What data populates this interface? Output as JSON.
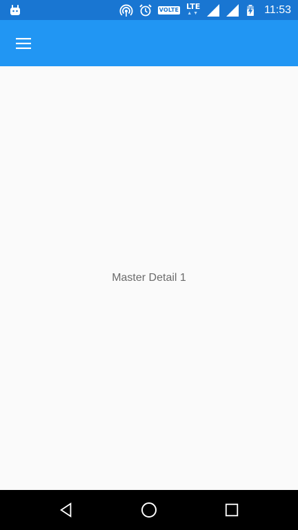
{
  "status_bar": {
    "time": "11:53",
    "network_badge": "VOLTE",
    "network_type": "LTE",
    "network_arrows": "▲▼",
    "icons": [
      "android-notification-icon",
      "hotspot-icon",
      "alarm-icon",
      "volte-icon",
      "lte-icon",
      "signal-icon",
      "signal-icon-2",
      "battery-charging-icon"
    ]
  },
  "app_bar": {
    "menu_icon": "hamburger-menu-icon",
    "color": "#2196f3"
  },
  "content": {
    "text": "Master Detail 1"
  },
  "nav_bar": {
    "buttons": [
      "back-icon",
      "home-icon",
      "recents-icon"
    ]
  },
  "colors": {
    "status_bar": "#1976d2",
    "app_bar": "#2196f3",
    "background": "#fafafa",
    "nav_bar": "#000000"
  }
}
